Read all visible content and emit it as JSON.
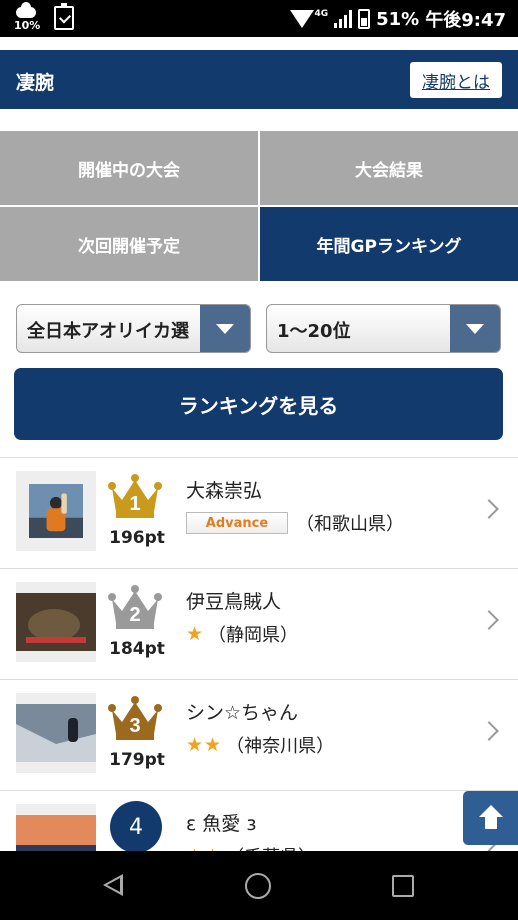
{
  "status_bar": {
    "weather_pct": "10%",
    "network": "4G",
    "battery": "51%",
    "time": "午後9:47"
  },
  "header": {
    "title": "凄腕",
    "about_link": "凄腕とは"
  },
  "tabs": [
    {
      "label": "開催中の大会"
    },
    {
      "label": "大会結果"
    },
    {
      "label": "次回開催予定"
    },
    {
      "label": "年間GPランキング"
    }
  ],
  "filters": {
    "tournament": "全日本アオリイカ選",
    "range": "1〜20位"
  },
  "view_button": "ランキングを見る",
  "ranking": [
    {
      "rank": "1",
      "points": "196pt",
      "name": "大森崇弘",
      "badge": "Advance",
      "stars": "",
      "pref": "（和歌山県）",
      "medal": "gold"
    },
    {
      "rank": "2",
      "points": "184pt",
      "name": "伊豆鳥賊人",
      "badge": "",
      "stars": "★",
      "pref": "（静岡県）",
      "medal": "silver"
    },
    {
      "rank": "3",
      "points": "179pt",
      "name": "シン☆ちゃん",
      "badge": "",
      "stars": "★★",
      "pref": "（神奈川県）",
      "medal": "bronze"
    },
    {
      "rank": "4",
      "points": "",
      "name": "ε 魚愛 з",
      "badge": "",
      "stars": "★★",
      "pref": "（千葉県）",
      "medal": ""
    }
  ],
  "colors": {
    "primary": "#123a6d",
    "tab_inactive": "#a8a8a8",
    "gold": "#c99a1b",
    "silver": "#9a9a9a",
    "bronze": "#9b6a1f",
    "star": "#f4a11c"
  }
}
